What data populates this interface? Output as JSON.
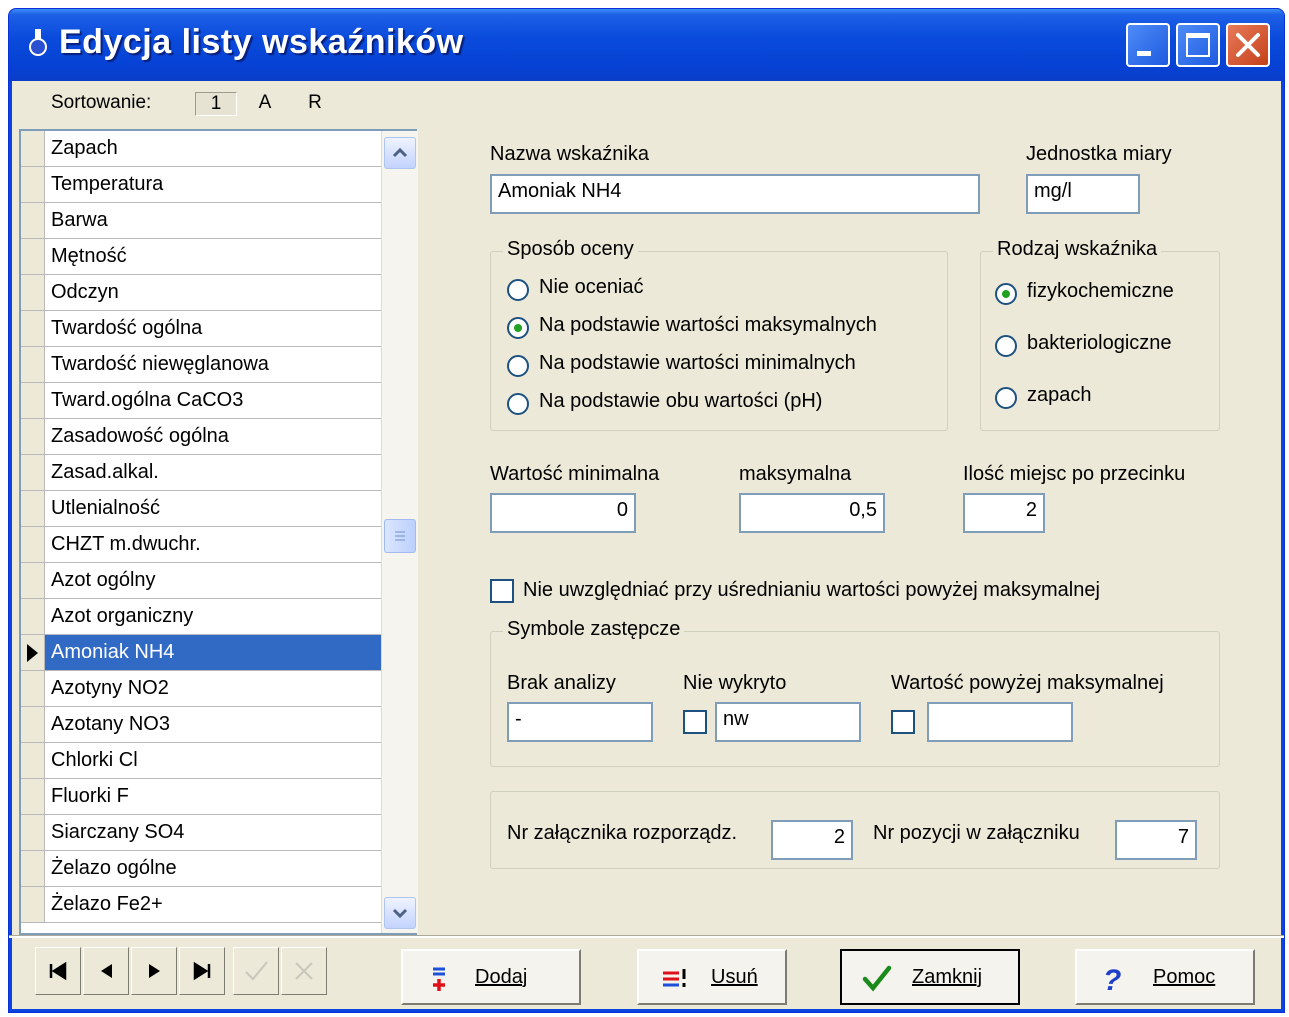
{
  "window": {
    "title": "Edycja listy wskaźników"
  },
  "sorting": {
    "label": "Sortowanie:",
    "keys": [
      "1",
      "A",
      "R"
    ]
  },
  "indicators": [
    "Zapach",
    "Temperatura",
    "Barwa",
    "Mętność",
    "Odczyn",
    "Twardość ogólna",
    "Twardość niewęglanowa",
    "Tward.ogólna CaCO3",
    "Zasadowość ogólna",
    "Zasad.alkal.",
    "Utlenialność",
    "CHZT m.dwuchr.",
    "Azot ogólny",
    "Azot organiczny",
    "Amoniak NH4",
    "Azotyny NO2",
    "Azotany NO3",
    "Chlorki Cl",
    "Fluorki F",
    "Siarczany SO4",
    "Żelazo ogólne",
    "Żelazo Fe2+"
  ],
  "selected_indicator": "Amoniak NH4",
  "form": {
    "name_label": "Nazwa wskaźnika",
    "name_value": "Amoniak NH4",
    "unit_label": "Jednostka miary",
    "unit_value": "mg/l",
    "assessment": {
      "title": "Sposób oceny",
      "options": [
        "Nie oceniać",
        "Na podstawie wartości maksymalnych",
        "Na podstawie wartości minimalnych",
        "Na podstawie obu wartości (pH)"
      ],
      "selected": "Na podstawie wartości maksymalnych"
    },
    "type": {
      "title": "Rodzaj wskaźnika",
      "options": [
        "fizykochemiczne",
        "bakteriologiczne",
        "zapach"
      ],
      "selected": "fizykochemiczne"
    },
    "min_label": "Wartość minimalna",
    "min_value": "0",
    "max_label": "maksymalna",
    "max_value": "0,5",
    "decimals_label": "Ilość miejsc po przecinku",
    "decimals_value": "2",
    "exclude_label": "Nie uwzględniać przy uśrednianiu wartości  powyżej maksymalnej",
    "exclude_checked": false,
    "symbols": {
      "title": "Symbole zastępcze",
      "no_analysis_label": "Brak analizy",
      "no_analysis_value": "-",
      "not_detected_label": "Nie wykryto",
      "not_detected_value": "nw",
      "above_max_label": "Wartość powyżej maksymalnej",
      "above_max_value": ""
    },
    "attachment_label": "Nr załącznika rozporządz.",
    "attachment_value": "2",
    "position_label": "Nr pozycji w  załączniku",
    "position_value": "7"
  },
  "buttons": {
    "add": "Dodaj",
    "delete": "Usuń",
    "close": "Zamknij",
    "help": "Pomoc"
  },
  "colors": {
    "titlebar": "#0a4bdc",
    "selection": "#316ac5",
    "face": "#ece9d8"
  }
}
